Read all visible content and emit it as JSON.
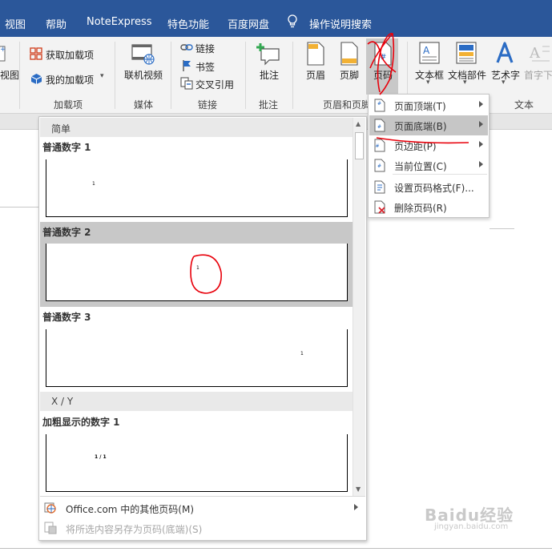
{
  "tabs": [
    "视图",
    "帮助",
    "NoteExpress",
    "特色功能",
    "百度网盘",
    "操作说明搜索"
  ],
  "ribbon": {
    "addins": {
      "get": "获取加载项",
      "mine": "我的加载项",
      "label": "加载项"
    },
    "media": {
      "video": "联机视频",
      "label": "媒体"
    },
    "links": {
      "link": "链接",
      "bookmark": "书签",
      "crossref": "交叉引用",
      "label": "链接"
    },
    "comments": {
      "comment": "批注",
      "label": "批注"
    },
    "headerfooter": {
      "header": "页眉",
      "footer": "页脚",
      "pagenum": "页码",
      "label": "页眉和页脚"
    },
    "text": {
      "textbox": "文本框",
      "parts": "文档部件",
      "wordart": "艺术字",
      "dropcap": "首字下",
      "label": "文本"
    },
    "left_fragment": "视图"
  },
  "gallery": {
    "section_simple": "简单",
    "section_xy": "X / Y",
    "items": [
      {
        "title": "普通数字 1",
        "number": "1"
      },
      {
        "title": "普通数字 2",
        "number": "1"
      },
      {
        "title": "普通数字 3",
        "number": "1"
      },
      {
        "title": "加粗显示的数字 1",
        "number": "1 / 1"
      }
    ],
    "footer_more": "Office.com 中的其他页码(M)",
    "footer_save": "将所选内容另存为页码(底端)(S)"
  },
  "menu": {
    "items": [
      {
        "label": "页面顶端(T)",
        "submenu": true
      },
      {
        "label": "页面底端(B)",
        "submenu": true
      },
      {
        "label": "页边距(P)",
        "submenu": true
      },
      {
        "label": "当前位置(C)",
        "submenu": true
      },
      {
        "label": "设置页码格式(F)...",
        "submenu": false
      },
      {
        "label": "删除页码(R)",
        "submenu": false
      }
    ]
  },
  "watermark": {
    "main": "Baidu经验",
    "sub": "jingyan.baidu.com"
  },
  "colors": {
    "tab_bar": "#2b579a",
    "ribbon_bg": "#f3f3f3",
    "annotation_red": "#e8000b",
    "selected_bg": "#c8c8c8"
  }
}
